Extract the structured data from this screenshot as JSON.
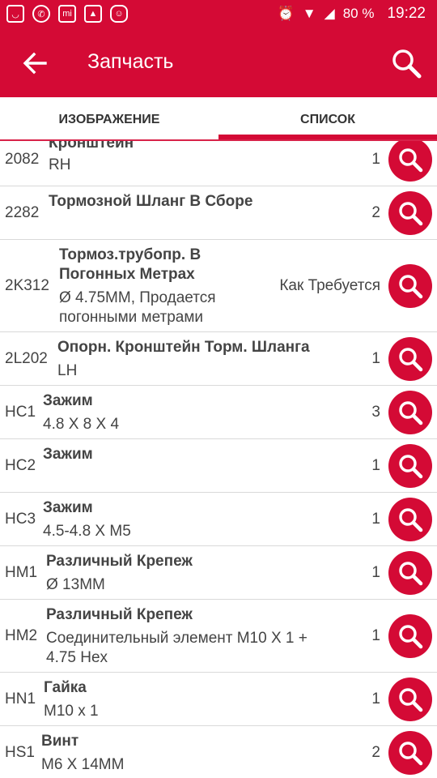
{
  "status": {
    "battery": "80 %",
    "time": "19:22"
  },
  "header": {
    "title": "Запчасть"
  },
  "tabs": [
    {
      "label": "ИЗОБРАЖЕНИЕ"
    },
    {
      "label": "СПИСОК"
    }
  ],
  "colors": {
    "brand": "#d40a35",
    "divider": "#d9d9d9"
  },
  "items": [
    {
      "code": "2082",
      "name": "Кронштейн",
      "desc": "RH",
      "qty": "1"
    },
    {
      "code": "2282",
      "name": "Тормозной Шланг В Сборе",
      "desc": "",
      "qty": "2"
    },
    {
      "code": "2K312",
      "name_line1": "Тормоз.трубопр. В",
      "name_line2": "Погонных Метрах",
      "desc_line1": "Ø 4.75MM, Продается",
      "desc_line2": "погонными метрами",
      "qty": "Как Требуется"
    },
    {
      "code": "2L202",
      "name": "Опорн. Кронштейн Торм. Шланга",
      "desc": "LH",
      "qty": "1"
    },
    {
      "code": "HC1",
      "name": "Зажим",
      "desc": "4.8 X 8 X 4",
      "qty": "3"
    },
    {
      "code": "HC2",
      "name": "Зажим",
      "desc": "",
      "qty": "1"
    },
    {
      "code": "HC3",
      "name": "Зажим",
      "desc": "4.5-4.8 X M5",
      "qty": "1"
    },
    {
      "code": "HM1",
      "name": "Различный Крепеж",
      "desc": "Ø 13MM",
      "qty": "1"
    },
    {
      "code": "HM2",
      "name": "Различный Крепеж",
      "desc_line1": "Соединительный элемент M10 X 1 +",
      "desc_line2": "4.75 Hex",
      "qty": "1"
    },
    {
      "code": "HN1",
      "name": "Гайка",
      "desc": "M10 x 1",
      "qty": "1"
    },
    {
      "code": "HS1",
      "name": "Винт",
      "desc": "M6 X 14MM",
      "qty": "2"
    }
  ]
}
